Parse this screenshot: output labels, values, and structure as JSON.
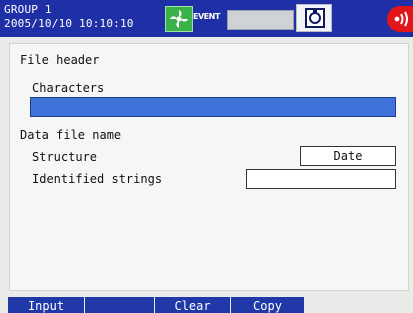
{
  "status_bar": {
    "group": "GROUP 1",
    "datetime": "2005/10/10 10:10:10",
    "event_label": "EVENT",
    "icons": [
      "event-fan-icon",
      "save-media-icon",
      "alarm-icon"
    ]
  },
  "form": {
    "file_header_label": "File header",
    "characters_label": "Characters",
    "characters_value": "",
    "data_file_name_label": "Data file name",
    "structure_label": "Structure",
    "structure_value": "Date",
    "identified_strings_label": "Identified strings",
    "identified_strings_value": ""
  },
  "softkeys": [
    "Input",
    "",
    "Clear",
    "Copy"
  ],
  "colors": {
    "topbar": "#1f2fa6",
    "selected_field": "#3f72d8",
    "softkey": "#2139a8",
    "alarm": "#e0161a",
    "event": "#3bb34a"
  }
}
